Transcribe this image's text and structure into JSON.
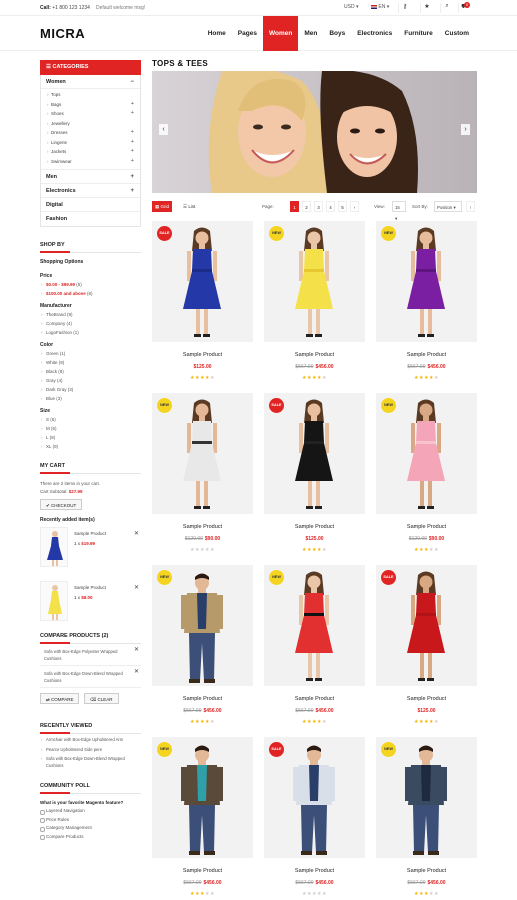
{
  "topbar": {
    "call_label": "Call:",
    "phone": "+1 800 123 1234",
    "welcome": "Default welcome msg!",
    "currency": "USD",
    "language": "EN",
    "cart_count": "0",
    "icons": [
      "key-icon",
      "star-icon",
      "search-icon",
      "cart-icon"
    ]
  },
  "header": {
    "logo": "MICRA",
    "nav": [
      "Home",
      "Pages",
      "Women",
      "Men",
      "Boys",
      "Electronics",
      "Furniture",
      "Custom"
    ],
    "active": "Women",
    "accent": "#e02424"
  },
  "sidebar": {
    "categories_title": "CATEGORIES",
    "women": "Women",
    "women_subs": [
      "Tops",
      "Bags",
      "Shoes",
      "Jewellery",
      "Dresses",
      "Lingerie",
      "Jackets",
      "Swimwear"
    ],
    "others": [
      "Men",
      "Electronics",
      "Digital",
      "Fashion"
    ],
    "shop_by": "SHOP BY",
    "shopping_options": "Shopping Options",
    "price_title": "Price",
    "prices": [
      {
        "range": "$0.00 - $99.99",
        "count": "(5)"
      },
      {
        "range": "$100.00 and above",
        "count": "(6)"
      }
    ],
    "manufacturer_title": "Manufacturer",
    "manufacturers": [
      "TheBrand (9)",
      "Company (4)",
      "LogoFashion (1)"
    ],
    "color_title": "Color",
    "colors": [
      "Green (1)",
      "White (9)",
      "Black (9)",
      "Gray (4)",
      "Dark Gray (3)",
      "Blue (3)"
    ],
    "size_title": "Size",
    "sizes": [
      "S (6)",
      "M (6)",
      "L (9)",
      "XL (9)"
    ],
    "cart_title": "MY CART",
    "cart_text": "There are 2 items in your cart.",
    "cart_subtotal_label": "Cart Subtotal:",
    "cart_subtotal": "$27.99",
    "checkout": "CHECKOUT",
    "recent_added": "Recently added item(s)",
    "mini_items": [
      {
        "name": "Sample Product",
        "qty": "1 x",
        "price": "$19.99"
      },
      {
        "name": "Sample Product",
        "qty": "1 x",
        "price": "$8.00"
      }
    ],
    "compare_title": "COMPARE PRODUCTS (2)",
    "compare_items": [
      "Sofa with Box-Edge Polyester Wrapped Cushions",
      "Sofa with Box-Edge Down-Blend Wrapped Cushions"
    ],
    "compare_btn": "COMPARE",
    "clear_btn": "CLEAR",
    "recent_title": "RECENTLY VIEWED",
    "recent_items": [
      "Armchair with Box-Edge Upholstered Arm",
      "Pearce Upholstered Side pere",
      "Sofa with Box-Edge Down-Blend Wrapped Cushions"
    ],
    "poll_title": "COMMUNITY POLL",
    "poll_question": "What is your favorite Magento feature?",
    "poll_options": [
      "Layered Navigation",
      "Price Rules",
      "Category Management",
      "Compare Products"
    ]
  },
  "main": {
    "title": "TOPS & TEES",
    "toolbar": {
      "grid": "Grid",
      "list": "List",
      "page_label": "Page:",
      "pages": [
        "1",
        "2",
        "3",
        "4",
        "5"
      ],
      "active_page": "1",
      "view_label": "View:",
      "view_value": "15",
      "sort_label": "Sort By:",
      "sort_value": "Position"
    },
    "products": [
      {
        "badge": "SALE",
        "name": "Sample Product",
        "old": "",
        "price": "$125.00",
        "rating": 4,
        "dress": "#2438a8",
        "dress2": "#1c2c88",
        "skin": "#e8c0a0"
      },
      {
        "badge": "NEW",
        "name": "Sample Product",
        "old": "$567.00",
        "price": "$456.00",
        "rating": 4,
        "dress": "#f4e14a",
        "dress2": "#e8c830",
        "skin": "#eac6a8"
      },
      {
        "badge": "NEW",
        "name": "Sample Product",
        "old": "$567.00",
        "price": "$456.00",
        "rating": 4,
        "dress": "#7b1fa2",
        "dress2": "#5e1580",
        "skin": "#e6bc9c"
      },
      {
        "badge": "NEW",
        "name": "Sample Product",
        "old": "$120.00",
        "price": "$90.00",
        "rating": 0,
        "dress": "#e8e8e8",
        "dress2": "#333333",
        "skin": "#e4b896"
      },
      {
        "badge": "SALE",
        "name": "Sample Product",
        "old": "",
        "price": "$125.00",
        "rating": 4,
        "dress": "#151515",
        "dress2": "#222222",
        "skin": "#e8c0a0"
      },
      {
        "badge": "NEW",
        "name": "Sample Product",
        "old": "$120.00",
        "price": "$90.00",
        "rating": 3,
        "dress": "#f4a6b8",
        "dress2": "#f8c4cc",
        "skin": "#d9a884"
      },
      {
        "badge": "NEW",
        "name": "Sample Product",
        "old": "$567.00",
        "price": "$456.00",
        "rating": 4,
        "dress": "#b79a6a",
        "dress2": "#2a3e6a",
        "skin": "#e2b896"
      },
      {
        "badge": "NEW",
        "name": "Sample Product",
        "old": "$567.00",
        "price": "$456.00",
        "rating": 4,
        "dress": "#e23030",
        "dress2": "#111111",
        "skin": "#eac6a8"
      },
      {
        "badge": "SALE",
        "name": "Sample Product",
        "old": "",
        "price": "$125.00",
        "rating": 4,
        "dress": "#c8181c",
        "dress2": "#b01418",
        "skin": "#d8a882"
      },
      {
        "badge": "NEW",
        "name": "Sample Product",
        "old": "$567.00",
        "price": "$456.00",
        "rating": 3,
        "dress": "#5a4a3a",
        "dress2": "#2fa0a8",
        "skin": "#e2b896"
      },
      {
        "badge": "SALE",
        "name": "Sample Product",
        "old": "$567.00",
        "price": "$456.00",
        "rating": 0,
        "dress": "#d8dfe8",
        "dress2": "#2a3e6a",
        "skin": "#e2b896"
      },
      {
        "badge": "NEW",
        "name": "Sample Product",
        "old": "$567.00",
        "price": "$456.00",
        "rating": 3,
        "dress": "#3a4a60",
        "dress2": "#1e2a40",
        "skin": "#e2b896"
      }
    ]
  }
}
